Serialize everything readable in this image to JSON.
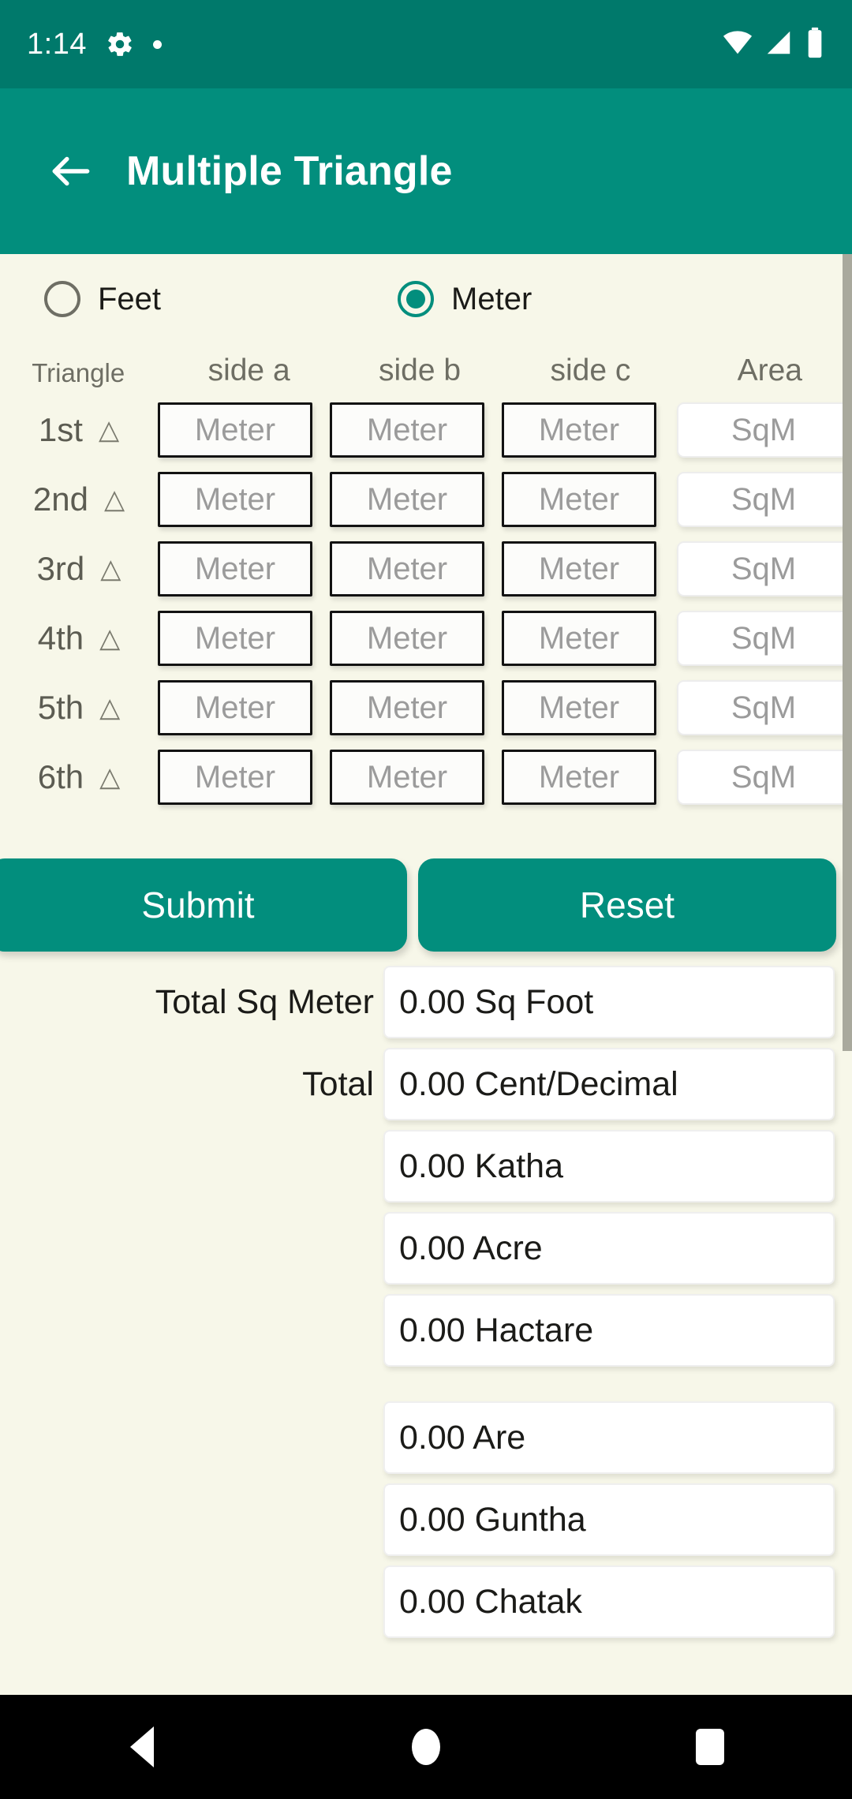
{
  "status_bar": {
    "time": "1:14",
    "icons": [
      "gear-icon",
      "dot-icon",
      "wifi-icon",
      "signal-icon",
      "battery-icon"
    ]
  },
  "app_bar": {
    "back_icon": "arrow-left-icon",
    "title": "Multiple Triangle"
  },
  "unit_selector": {
    "options": [
      {
        "label": "Feet",
        "selected": false
      },
      {
        "label": "Meter",
        "selected": true
      }
    ]
  },
  "table": {
    "headers": [
      "Triangle",
      "side a",
      "side b",
      "side c",
      "Area"
    ],
    "side_placeholder": "Meter",
    "area_placeholder": "SqM",
    "triangle_glyph": "△",
    "rows": [
      {
        "label": "1st",
        "side_a": "",
        "side_b": "",
        "side_c": "",
        "area": ""
      },
      {
        "label": "2nd",
        "side_a": "",
        "side_b": "",
        "side_c": "",
        "area": ""
      },
      {
        "label": "3rd",
        "side_a": "",
        "side_b": "",
        "side_c": "",
        "area": ""
      },
      {
        "label": "4th",
        "side_a": "",
        "side_b": "",
        "side_c": "",
        "area": ""
      },
      {
        "label": "5th",
        "side_a": "",
        "side_b": "",
        "side_c": "",
        "area": ""
      },
      {
        "label": "6th",
        "side_a": "",
        "side_b": "",
        "side_c": "",
        "area": ""
      }
    ]
  },
  "actions": {
    "submit_label": "Submit",
    "reset_label": "Reset"
  },
  "results": {
    "label_total_sq_meter": "Total Sq Meter",
    "label_total": "Total",
    "fields": [
      {
        "value": "0.00 Sq Foot"
      },
      {
        "value": "0.00 Cent/Decimal"
      },
      {
        "value": "0.00 Katha"
      },
      {
        "value": "0.00 Acre"
      },
      {
        "value": "0.00 Hactare"
      },
      {
        "value": "0.00 Are"
      },
      {
        "value": "0.00 Guntha"
      },
      {
        "value": "0.00 Chatak"
      }
    ]
  },
  "nav_bar": {
    "back": "back-triangle-icon",
    "home": "home-circle-icon",
    "recents": "recents-square-icon"
  },
  "colors": {
    "status_bar": "#00796B",
    "app_bar": "#028E7D",
    "accent": "#028E7D",
    "page_bg": "#F7F7E9",
    "nav_bg": "#000000"
  }
}
